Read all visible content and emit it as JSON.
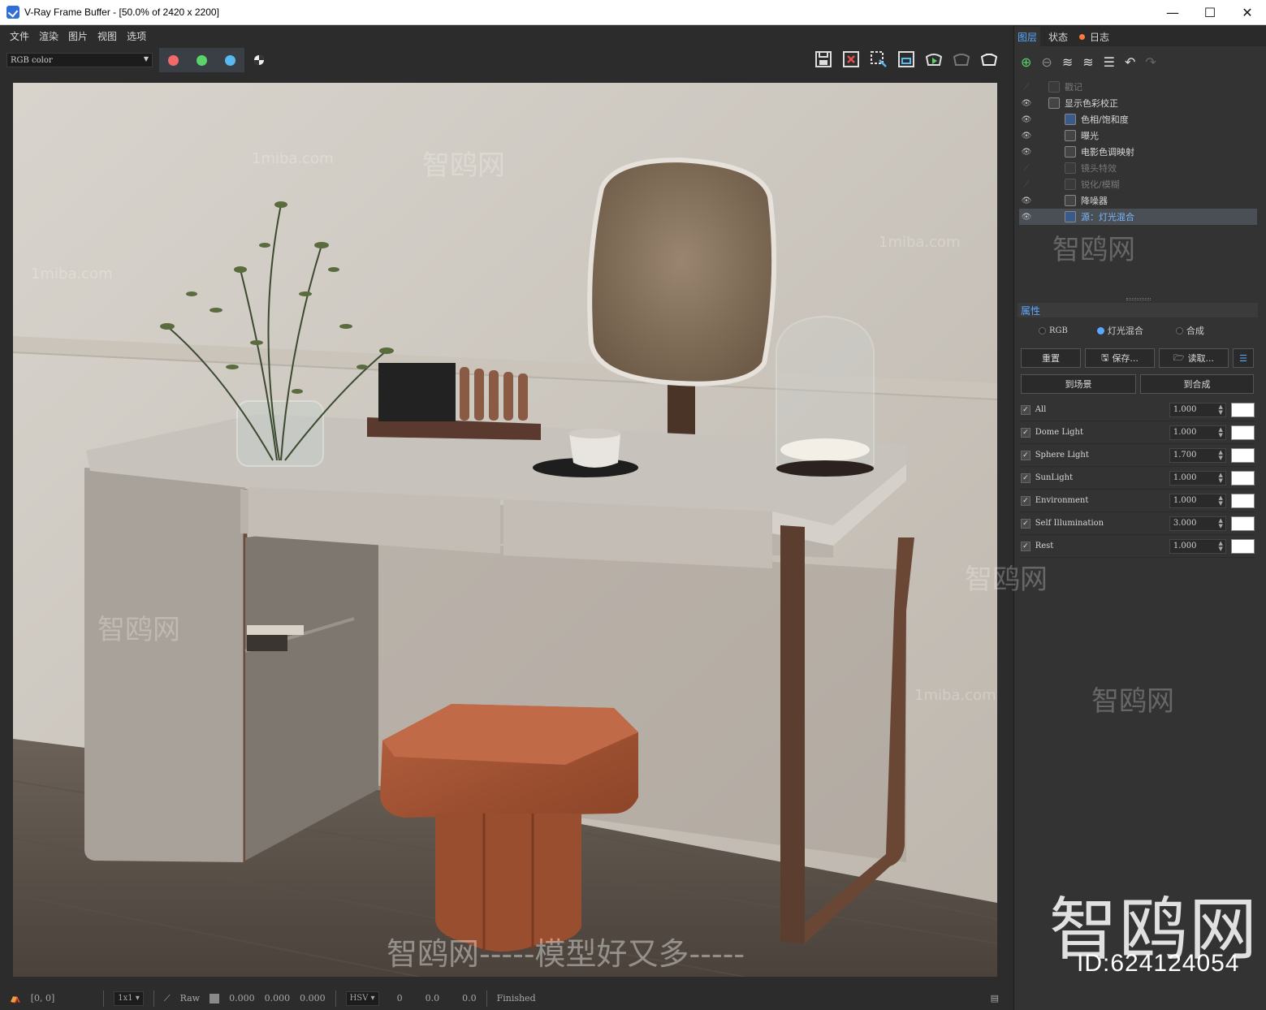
{
  "window": {
    "title": "V-Ray Frame Buffer - [50.0% of 2420 x 2200]",
    "minimize": "—",
    "maximize": "☐",
    "close": "✕"
  },
  "menu": [
    "文件",
    "渲染",
    "图片",
    "视图",
    "选项"
  ],
  "toolbar": {
    "channel": "RGB color",
    "channel_dots": [
      {
        "name": "red-channel",
        "color": "#f06a6a"
      },
      {
        "name": "green-channel",
        "color": "#59d36a"
      },
      {
        "name": "blue-channel",
        "color": "#5ab9f0"
      }
    ],
    "icons": [
      "save-icon",
      "clear-image-icon",
      "region-render-icon",
      "compare-icon",
      "render-interactive-icon",
      "render-disabled-icon",
      "render-icon"
    ]
  },
  "panel": {
    "tabs": [
      "图层",
      "状态",
      "日志"
    ],
    "layers": [
      {
        "label": "戳记",
        "visible": false
      },
      {
        "label": "显示色彩校正",
        "visible": true
      },
      {
        "label": "色相/饱和度",
        "visible": true
      },
      {
        "label": "曝光",
        "visible": true
      },
      {
        "label": "电影色调映射",
        "visible": true
      },
      {
        "label": "镜头特效",
        "visible": false
      },
      {
        "label": "锐化/模糊",
        "visible": false
      },
      {
        "label": "降噪器",
        "visible": true
      },
      {
        "label": "源：灯光混合",
        "visible": true,
        "selected": true
      }
    ],
    "props_title": "属性",
    "modes": [
      "RGB",
      "灯光混合",
      "合成"
    ],
    "mode_selected": "灯光混合",
    "buttons": {
      "reset": "重置",
      "save": "保存...",
      "load": "读取...",
      "to_scene": "到场景",
      "to_composite": "到合成"
    },
    "lightmix": [
      {
        "name": "All",
        "value": "1.000"
      },
      {
        "name": "Dome Light",
        "value": "1.000"
      },
      {
        "name": "Sphere Light",
        "value": "1.700"
      },
      {
        "name": "SunLight",
        "value": "1.000"
      },
      {
        "name": "Environment",
        "value": "1.000"
      },
      {
        "name": "Self Illumination",
        "value": "3.000"
      },
      {
        "name": "Rest",
        "value": "1.000"
      }
    ]
  },
  "status": {
    "coords": "[0, 0]",
    "scale": "1x1",
    "raw": "Raw",
    "rgb": [
      "0.000",
      "0.000",
      "0.000"
    ],
    "colorspace": "HSV",
    "hsv": [
      "0",
      "0.0",
      "0.0"
    ],
    "state": "Finished"
  },
  "watermarks": {
    "site": "1miba.com",
    "brand": "智鸥网",
    "slogan": "智鸥网-----模型好又多-----",
    "id": "ID:624124054"
  }
}
